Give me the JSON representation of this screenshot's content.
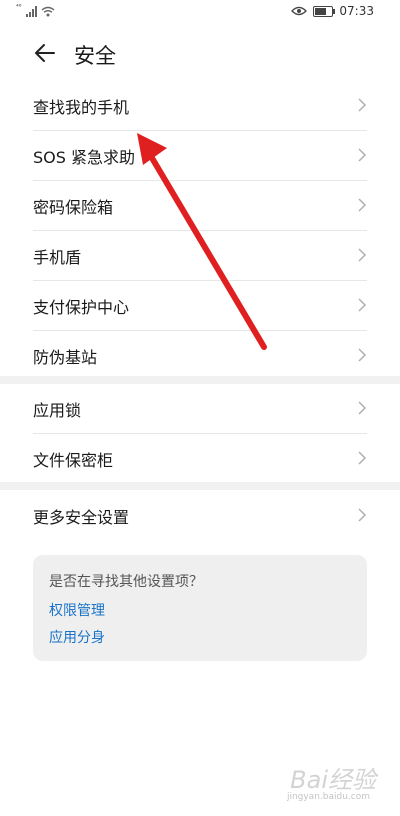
{
  "status_bar": {
    "signal_label": "⁴⁶",
    "time": "07:33",
    "icons": [
      "signal-icon",
      "wifi-icon",
      "eye-icon",
      "battery-icon"
    ]
  },
  "header": {
    "title": "安全",
    "back_icon": "arrow-left-icon"
  },
  "group1": [
    {
      "label": "查找我的手机"
    },
    {
      "label": "SOS 紧急求助"
    },
    {
      "label": "密码保险箱"
    },
    {
      "label": "手机盾"
    },
    {
      "label": "支付保护中心"
    },
    {
      "label": "防伪基站"
    }
  ],
  "group2": [
    {
      "label": "应用锁"
    },
    {
      "label": "文件保密柜"
    }
  ],
  "group3": [
    {
      "label": "更多安全设置"
    }
  ],
  "suggest_card": {
    "question": "是否在寻找其他设置项？",
    "links": [
      "权限管理",
      "应用分身"
    ]
  },
  "annotation": {
    "arrow_color": "#e02020"
  },
  "watermark": {
    "text": "Bai经验",
    "sub": "jingyan.baidu.com"
  }
}
